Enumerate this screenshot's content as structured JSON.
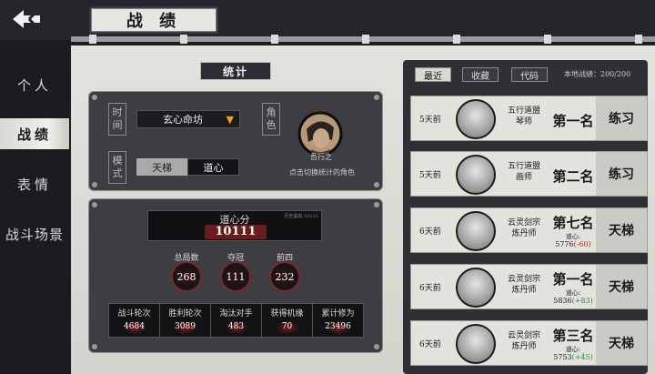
{
  "header": {
    "title": "战 绩"
  },
  "sidebar": {
    "items": [
      {
        "label": "个人",
        "active": false
      },
      {
        "label": "战绩",
        "active": true
      },
      {
        "label": "表情",
        "active": false
      },
      {
        "label": "战斗场景",
        "active": false
      }
    ]
  },
  "stats": {
    "tab_label": "统计",
    "time_label": [
      "时",
      "间"
    ],
    "mode_label": [
      "模",
      "式"
    ],
    "role_label": [
      "角",
      "色"
    ],
    "time_value": "玄心命坊",
    "mode_options": [
      "天梯",
      "道心"
    ],
    "mode_selected": "道心",
    "character_name": "吾行之",
    "character_hint": "点击切换统计的角色",
    "dao_title": "道心分",
    "dao_note": "历史最高:10111",
    "dao_value": "10111",
    "mini": [
      {
        "label": "总局数",
        "value": "268"
      },
      {
        "label": "夺冠",
        "value": "111"
      },
      {
        "label": "前四",
        "value": "232"
      }
    ],
    "table": [
      {
        "label": "战斗轮次",
        "value": "4684"
      },
      {
        "label": "胜利轮次",
        "value": "3089"
      },
      {
        "label": "淘汰对手",
        "value": "483"
      },
      {
        "label": "获得机缘",
        "value": "70"
      },
      {
        "label": "累计修为",
        "value": "23496"
      }
    ]
  },
  "records": {
    "tabs": [
      "最近",
      "收藏",
      "代码"
    ],
    "active_tab": "最近",
    "local_count": "本地战绩：200/200",
    "items": [
      {
        "time": "5天前",
        "sect": "五行道盟",
        "role": "琴师",
        "rank": "第一名",
        "dao_label": "",
        "dao_value": "",
        "dao_delta": "",
        "mode": "练习"
      },
      {
        "time": "5天前",
        "sect": "五行道盟",
        "role": "画师",
        "rank": "第二名",
        "dao_label": "",
        "dao_value": "",
        "dao_delta": "",
        "mode": "练习"
      },
      {
        "time": "6天前",
        "sect": "云灵剑宗",
        "role": "炼丹师",
        "rank": "第七名",
        "dao_label": "道心:",
        "dao_value": "5776",
        "dao_delta": "(-60)",
        "mode": "天梯"
      },
      {
        "time": "6天前",
        "sect": "云灵剑宗",
        "role": "炼丹师",
        "rank": "第一名",
        "dao_label": "道心:",
        "dao_value": "5836",
        "dao_delta": "(+83)",
        "mode": "天梯"
      },
      {
        "time": "6天前",
        "sect": "云灵剑宗",
        "role": "炼丹师",
        "rank": "第三名",
        "dao_label": "道心:",
        "dao_value": "5753",
        "dao_delta": "(+45)",
        "mode": "天梯"
      }
    ]
  },
  "colors": {
    "accent_red": "#7a1c1c",
    "positive": "#1f8f33",
    "negative": "#c02020",
    "caret": "#f0a020"
  }
}
